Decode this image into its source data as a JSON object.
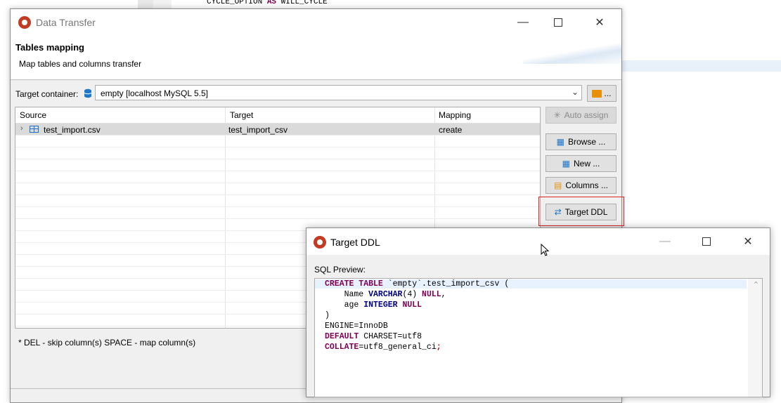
{
  "background": {
    "code_line": {
      "prefix": "CYCLE_OPTION ",
      "kw": "AS",
      "suffix": " WILL_CYCLE"
    }
  },
  "main_dialog": {
    "title": "Data Transfer",
    "page_title": "Tables mapping",
    "page_description": "Map tables and columns transfer",
    "target_container_label": "Target container:",
    "target_container_value": "empty  [localhost MySQL 5.5]",
    "folder_button_label": "...",
    "table": {
      "columns": [
        "Source",
        "Target",
        "Mapping"
      ],
      "rows": [
        {
          "source": "test_import.csv",
          "target": "test_import_csv",
          "mapping": "create"
        }
      ]
    },
    "buttons": {
      "auto_assign": "Auto assign",
      "browse": "Browse ...",
      "new": "New ...",
      "columns": "Columns ...",
      "target_ddl": "Target DDL"
    },
    "hint": "* DEL - skip column(s)  SPACE - map column(s)"
  },
  "ddl_dialog": {
    "title": "Target DDL",
    "sql_preview_label": "SQL Preview:",
    "sql": {
      "l1_kw": "CREATE TABLE",
      "l1_rest": " `empty`.test_import_csv (",
      "l2_pre": "    Name ",
      "l2_type": "VARCHAR",
      "l2_mid": "(4) ",
      "l2_kw": "NULL",
      "l2_end": ",",
      "l3_pre": "    age ",
      "l3_type": "INTEGER",
      "l3_sp": " ",
      "l3_kw": "NULL",
      "l4": ")",
      "l5": "ENGINE=InnoDB",
      "l6_kw": "DEFAULT",
      "l6_rest": " CHARSET=utf8",
      "l7_kw": "COLLATE",
      "l7_rest": "=utf8_general_ci",
      "l7_end": ";"
    }
  },
  "colors": {
    "keyword": "#7f0055",
    "type": "#000080",
    "highlight_border": "#dd2222",
    "app_icon": "#c23b22"
  },
  "icons": {
    "app": "dbeaver-logo-icon",
    "database": "database-icon",
    "table": "table-icon",
    "folder": "folder-icon",
    "auto_assign": "asterisk-icon",
    "browse": "browse-table-icon",
    "new": "new-table-icon",
    "columns": "columns-icon",
    "target_ddl": "ddl-icon"
  }
}
